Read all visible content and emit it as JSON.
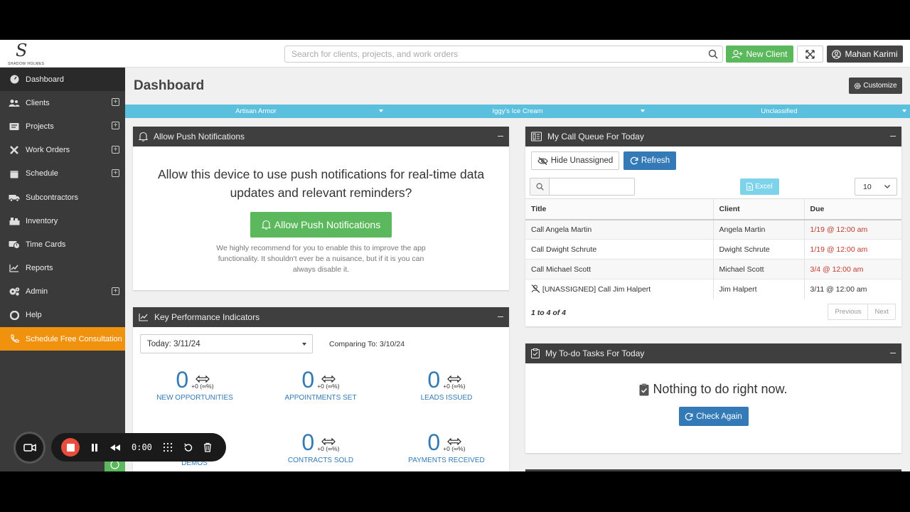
{
  "app": {
    "logo_mark": "S",
    "logo_name": "SHADOW HOLMES"
  },
  "topbar": {
    "search_placeholder": "Search for clients, projects, and work orders",
    "new_client_label": "New Client",
    "user_name": "Mahan Karimi"
  },
  "sidebar": {
    "items": [
      {
        "label": "Dashboard",
        "icon": "dashboard-icon",
        "expandable": false
      },
      {
        "label": "Clients",
        "icon": "users-icon",
        "expandable": true
      },
      {
        "label": "Projects",
        "icon": "projects-icon",
        "expandable": true
      },
      {
        "label": "Work Orders",
        "icon": "tools-icon",
        "expandable": true
      },
      {
        "label": "Schedule",
        "icon": "calendar-icon",
        "expandable": true
      },
      {
        "label": "Subcontractors",
        "icon": "truck-icon",
        "expandable": false
      },
      {
        "label": "Inventory",
        "icon": "inventory-icon",
        "expandable": false
      },
      {
        "label": "Time Cards",
        "icon": "time-card-icon",
        "expandable": false
      },
      {
        "label": "Reports",
        "icon": "chart-line-icon",
        "expandable": false
      },
      {
        "label": "Admin",
        "icon": "gears-icon",
        "expandable": true
      },
      {
        "label": "Help",
        "icon": "lifebuoy-icon",
        "expandable": false
      },
      {
        "label": "Schedule Free Consultation",
        "icon": "phone-icon",
        "expandable": false
      }
    ]
  },
  "main": {
    "title": "Dashboard",
    "customize_label": "Customize",
    "filters": [
      "Artisan Armor",
      "Iggy's Ice Cream",
      "Unclassified"
    ]
  },
  "push": {
    "header": "Allow Push Notifications",
    "message": "Allow this device to use push notifications for real-time data updates and relevant reminders?",
    "button": "Allow Push Notifications",
    "note": "We highly recommend for you to enable this to improve the app functionality. It shouldn't ever be a nuisance, but if it is you can always disable it."
  },
  "kpi": {
    "header": "Key Performance Indicators",
    "period": "Today: 3/11/24",
    "comparing": "Comparing To: 3/10/24",
    "items": [
      {
        "value": "0",
        "change": "+0 (∞%)",
        "label": "NEW OPPORTUNITIES"
      },
      {
        "value": "0",
        "change": "+0 (∞%)",
        "label": "APPOINTMENTS SET"
      },
      {
        "value": "0",
        "change": "+0 (∞%)",
        "label": "LEADS ISSUED"
      },
      {
        "value": "0",
        "change": "+0 (∞%)",
        "label": "CONTRACTS SOLD"
      },
      {
        "value": "0",
        "change": "+0 (∞%)",
        "label": "PAYMENTS RECEIVED"
      }
    ],
    "cut_label": "DEMOS"
  },
  "call_queue": {
    "header": "My Call Queue For Today",
    "hide_unassigned": "Hide Unassigned",
    "refresh": "Refresh",
    "excel": "Excel",
    "page_size": "10",
    "columns": [
      "Title",
      "Client",
      "Due"
    ],
    "rows": [
      {
        "title": "Call Angela Martin",
        "client": "Angela Martin",
        "due": "1/19 @ 12:00 am",
        "overdue": true,
        "unassigned": false
      },
      {
        "title": "Call Dwight Schrute",
        "client": "Dwight Schrute",
        "due": "1/19 @ 12:00 am",
        "overdue": true,
        "unassigned": false
      },
      {
        "title": "Call Michael Scott",
        "client": "Michael Scott",
        "due": "3/4 @ 12:00 am",
        "overdue": true,
        "unassigned": false
      },
      {
        "title": "[UNASSIGNED] Call Jim Halpert",
        "client": "Jim Halpert",
        "due": "3/11 @ 12:00 am",
        "overdue": false,
        "unassigned": true
      }
    ],
    "summary": "1 to 4 of 4",
    "prev": "Previous",
    "next": "Next"
  },
  "todo": {
    "header": "My To-do Tasks For Today",
    "message": "Nothing to do right now.",
    "button": "Check Again"
  },
  "recorder": {
    "time": "0:00"
  },
  "colors": {
    "green": "#5cb85c",
    "blue": "#337ab7",
    "info": "#5bc0de",
    "orange": "#f0920e",
    "overdue": "#c0392b",
    "dark": "#3f3f3f"
  }
}
